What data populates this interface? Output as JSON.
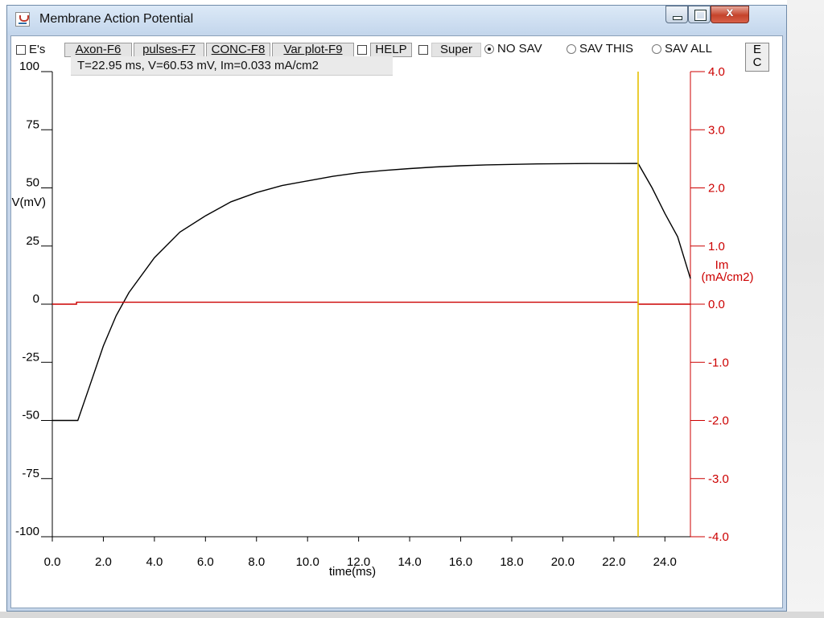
{
  "window": {
    "title": "Membrane Action Potential",
    "controls": {
      "minimize_icon": "minimize-icon",
      "maximize_icon": "maximize-icon",
      "close_icon": "x-icon"
    }
  },
  "toolbar": {
    "es_label": "E's",
    "axon_label": "Axon-F6",
    "pulses_label": "pulses-F7",
    "conc_label": "CONC-F8",
    "varplot_label": "Var plot-F9",
    "help_label": "HELP",
    "super_label": "Super",
    "radio": [
      {
        "label": "NO SAV",
        "checked": true
      },
      {
        "label": "SAV THIS",
        "checked": false
      },
      {
        "label": "SAV ALL",
        "checked": false
      }
    ],
    "ec_label_top": "E",
    "ec_label_bottom": "C"
  },
  "readout": "T=22.95 ms, V=60.53 mV, Im=0.033 mA/cm2",
  "colors": {
    "voltage": "#000000",
    "current": "#cc0000",
    "cursor": "#e6c000"
  },
  "chart_data": {
    "type": "line",
    "title": "",
    "xlabel": "time(ms)",
    "ylabel_left": "V(mV)",
    "ylabel_right": "Im\n(mA/cm2)",
    "xlim": [
      0,
      25
    ],
    "ylim_left": [
      -100,
      100
    ],
    "ylim_right": [
      -4.0,
      4.0
    ],
    "x_ticks": [
      "0.0",
      "2.0",
      "4.0",
      "6.0",
      "8.0",
      "10.0",
      "12.0",
      "14.0",
      "16.0",
      "18.0",
      "20.0",
      "22.0",
      "24.0"
    ],
    "y_left_ticks": [
      "100",
      "75",
      "50",
      "25",
      "0",
      "-25",
      "-50",
      "-75",
      "-100"
    ],
    "y_right_ticks": [
      "4.0",
      "3.0",
      "2.0",
      "1.0",
      "0.0",
      "-1.0",
      "-2.0",
      "-3.0",
      "-4.0"
    ],
    "cursor_x": 22.95,
    "series": [
      {
        "axis": "left",
        "x": [
          0,
          1,
          1.5,
          2,
          2.5,
          3,
          4,
          5,
          6,
          7,
          8,
          9,
          10,
          11,
          12,
          13,
          14,
          15,
          16,
          17,
          18,
          19,
          20,
          21,
          22,
          22.95,
          23.5,
          24,
          24.5,
          25
        ],
        "y": [
          -50,
          -50,
          -34,
          -18,
          -5,
          5,
          20,
          31,
          38,
          44,
          48,
          51,
          53,
          55,
          56.5,
          57.5,
          58.3,
          59,
          59.5,
          59.9,
          60.1,
          60.3,
          60.4,
          60.5,
          60.5,
          60.53,
          50,
          39,
          29,
          11
        ]
      },
      {
        "axis": "right",
        "x": [
          0,
          0.95,
          0.95,
          22.95,
          22.95,
          25
        ],
        "y": [
          0,
          0,
          0.033,
          0.033,
          0,
          0
        ]
      }
    ]
  }
}
